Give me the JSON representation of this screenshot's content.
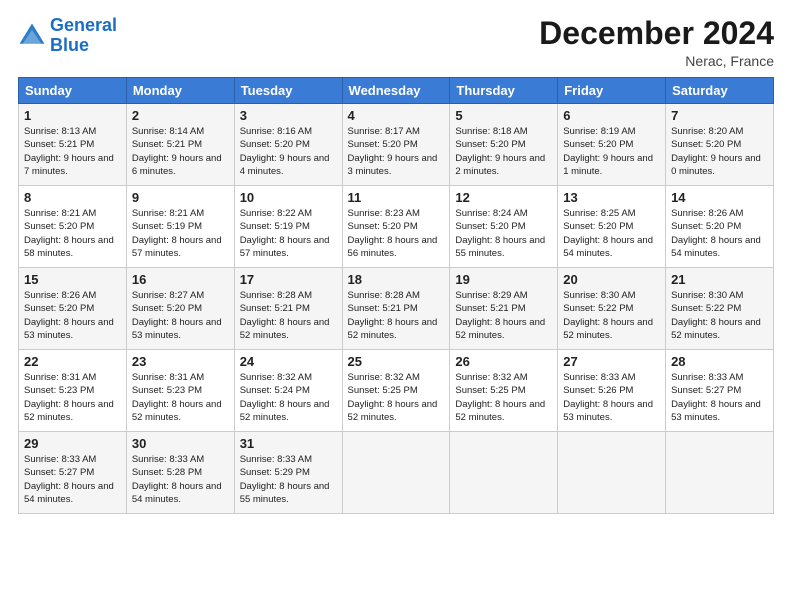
{
  "header": {
    "logo_text_general": "General",
    "logo_text_blue": "Blue",
    "month": "December 2024",
    "location": "Nerac, France"
  },
  "weekdays": [
    "Sunday",
    "Monday",
    "Tuesday",
    "Wednesday",
    "Thursday",
    "Friday",
    "Saturday"
  ],
  "weeks": [
    [
      {
        "day": "1",
        "sunrise": "8:13 AM",
        "sunset": "5:21 PM",
        "daylight": "9 hours and 7 minutes."
      },
      {
        "day": "2",
        "sunrise": "8:14 AM",
        "sunset": "5:21 PM",
        "daylight": "9 hours and 6 minutes."
      },
      {
        "day": "3",
        "sunrise": "8:16 AM",
        "sunset": "5:20 PM",
        "daylight": "9 hours and 4 minutes."
      },
      {
        "day": "4",
        "sunrise": "8:17 AM",
        "sunset": "5:20 PM",
        "daylight": "9 hours and 3 minutes."
      },
      {
        "day": "5",
        "sunrise": "8:18 AM",
        "sunset": "5:20 PM",
        "daylight": "9 hours and 2 minutes."
      },
      {
        "day": "6",
        "sunrise": "8:19 AM",
        "sunset": "5:20 PM",
        "daylight": "9 hours and 1 minute."
      },
      {
        "day": "7",
        "sunrise": "8:20 AM",
        "sunset": "5:20 PM",
        "daylight": "9 hours and 0 minutes."
      }
    ],
    [
      {
        "day": "8",
        "sunrise": "8:21 AM",
        "sunset": "5:20 PM",
        "daylight": "8 hours and 58 minutes."
      },
      {
        "day": "9",
        "sunrise": "8:21 AM",
        "sunset": "5:19 PM",
        "daylight": "8 hours and 57 minutes."
      },
      {
        "day": "10",
        "sunrise": "8:22 AM",
        "sunset": "5:19 PM",
        "daylight": "8 hours and 57 minutes."
      },
      {
        "day": "11",
        "sunrise": "8:23 AM",
        "sunset": "5:20 PM",
        "daylight": "8 hours and 56 minutes."
      },
      {
        "day": "12",
        "sunrise": "8:24 AM",
        "sunset": "5:20 PM",
        "daylight": "8 hours and 55 minutes."
      },
      {
        "day": "13",
        "sunrise": "8:25 AM",
        "sunset": "5:20 PM",
        "daylight": "8 hours and 54 minutes."
      },
      {
        "day": "14",
        "sunrise": "8:26 AM",
        "sunset": "5:20 PM",
        "daylight": "8 hours and 54 minutes."
      }
    ],
    [
      {
        "day": "15",
        "sunrise": "8:26 AM",
        "sunset": "5:20 PM",
        "daylight": "8 hours and 53 minutes."
      },
      {
        "day": "16",
        "sunrise": "8:27 AM",
        "sunset": "5:20 PM",
        "daylight": "8 hours and 53 minutes."
      },
      {
        "day": "17",
        "sunrise": "8:28 AM",
        "sunset": "5:21 PM",
        "daylight": "8 hours and 52 minutes."
      },
      {
        "day": "18",
        "sunrise": "8:28 AM",
        "sunset": "5:21 PM",
        "daylight": "8 hours and 52 minutes."
      },
      {
        "day": "19",
        "sunrise": "8:29 AM",
        "sunset": "5:21 PM",
        "daylight": "8 hours and 52 minutes."
      },
      {
        "day": "20",
        "sunrise": "8:30 AM",
        "sunset": "5:22 PM",
        "daylight": "8 hours and 52 minutes."
      },
      {
        "day": "21",
        "sunrise": "8:30 AM",
        "sunset": "5:22 PM",
        "daylight": "8 hours and 52 minutes."
      }
    ],
    [
      {
        "day": "22",
        "sunrise": "8:31 AM",
        "sunset": "5:23 PM",
        "daylight": "8 hours and 52 minutes."
      },
      {
        "day": "23",
        "sunrise": "8:31 AM",
        "sunset": "5:23 PM",
        "daylight": "8 hours and 52 minutes."
      },
      {
        "day": "24",
        "sunrise": "8:32 AM",
        "sunset": "5:24 PM",
        "daylight": "8 hours and 52 minutes."
      },
      {
        "day": "25",
        "sunrise": "8:32 AM",
        "sunset": "5:25 PM",
        "daylight": "8 hours and 52 minutes."
      },
      {
        "day": "26",
        "sunrise": "8:32 AM",
        "sunset": "5:25 PM",
        "daylight": "8 hours and 52 minutes."
      },
      {
        "day": "27",
        "sunrise": "8:33 AM",
        "sunset": "5:26 PM",
        "daylight": "8 hours and 53 minutes."
      },
      {
        "day": "28",
        "sunrise": "8:33 AM",
        "sunset": "5:27 PM",
        "daylight": "8 hours and 53 minutes."
      }
    ],
    [
      {
        "day": "29",
        "sunrise": "8:33 AM",
        "sunset": "5:27 PM",
        "daylight": "8 hours and 54 minutes."
      },
      {
        "day": "30",
        "sunrise": "8:33 AM",
        "sunset": "5:28 PM",
        "daylight": "8 hours and 54 minutes."
      },
      {
        "day": "31",
        "sunrise": "8:33 AM",
        "sunset": "5:29 PM",
        "daylight": "8 hours and 55 minutes."
      },
      null,
      null,
      null,
      null
    ]
  ]
}
